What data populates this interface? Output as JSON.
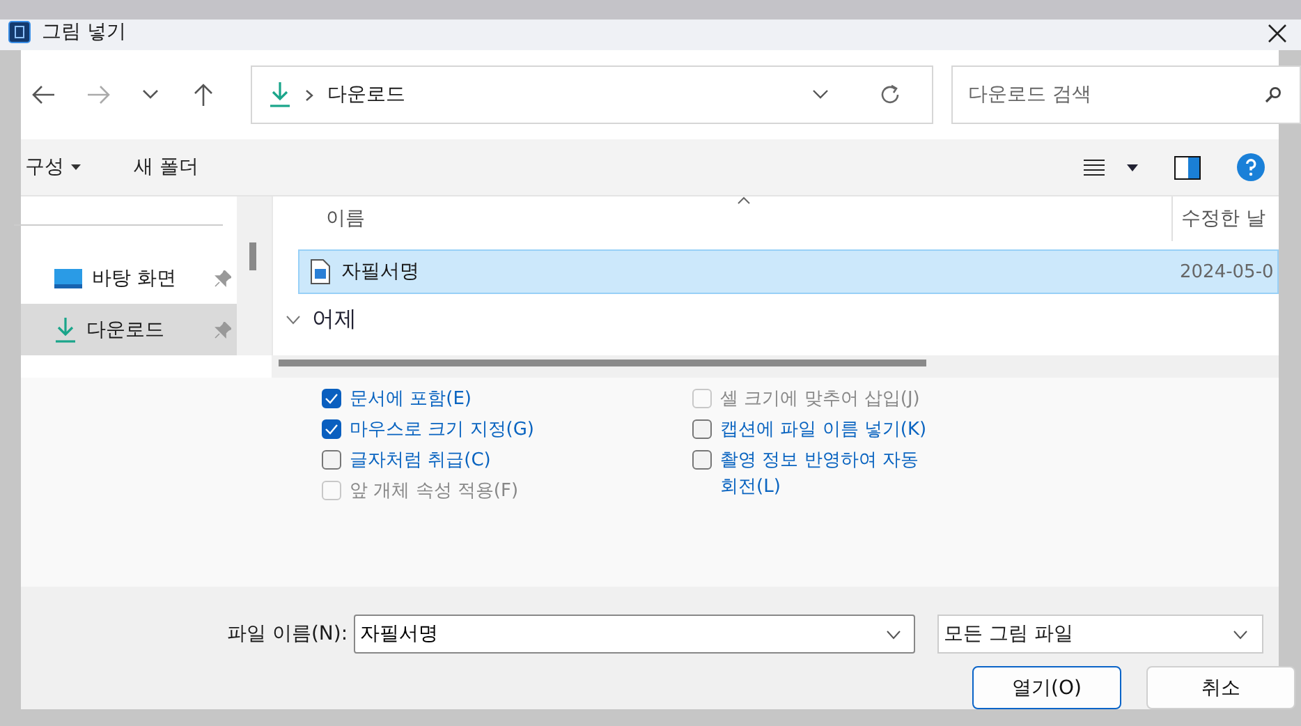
{
  "window": {
    "title": "그림 넣기"
  },
  "address": {
    "location": "다운로드",
    "search_placeholder": "다운로드 검색"
  },
  "toolbar": {
    "organize": "구성",
    "new_folder": "새 폴더"
  },
  "sidebar": {
    "items": [
      {
        "label": "바탕 화면",
        "kind": "desktop",
        "selected": false
      },
      {
        "label": "다운로드",
        "kind": "downloads",
        "selected": true
      }
    ]
  },
  "table": {
    "columns": [
      "이름",
      "수정한 날"
    ],
    "rows": [
      {
        "name": "자필서명",
        "modified": "2024-05-0",
        "selected": true
      }
    ],
    "group": "어제"
  },
  "options": {
    "left": [
      {
        "label": "문서에 포함(E)",
        "checked": true,
        "disabled": false
      },
      {
        "label": "마우스로 크기 지정(G)",
        "checked": true,
        "disabled": false
      },
      {
        "label": "글자처럼 취급(C)",
        "checked": false,
        "disabled": false
      },
      {
        "label": "앞 개체 속성 적용(F)",
        "checked": false,
        "disabled": true
      }
    ],
    "right": [
      {
        "label": "셀 크기에 맞추어 삽입(J)",
        "checked": false,
        "disabled": true
      },
      {
        "label": "캡션에 파일 이름 넣기(K)",
        "checked": false,
        "disabled": false
      },
      {
        "label": "촬영 정보 반영하여 자동 회전(L)",
        "checked": false,
        "disabled": false
      }
    ]
  },
  "footer": {
    "filename_label": "파일 이름(N):",
    "filename": "자필서명",
    "filetype": "모든 그림 파일",
    "buttons": [
      "열기(O)",
      "취소"
    ]
  }
}
